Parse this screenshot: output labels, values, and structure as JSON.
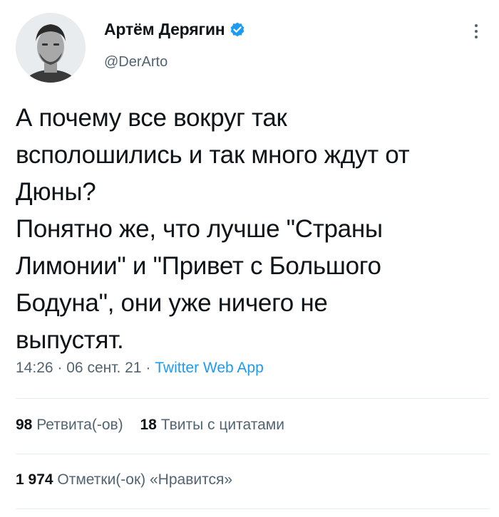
{
  "author": {
    "display_name": "Артём Дерягин",
    "handle": "@DerArto",
    "verified": true,
    "avatar_icon": "avatar-photo"
  },
  "tweet": {
    "text": "А почему все вокруг так\nвсполошились и так много ждут от\nДюны?\nПонятно же, что лучше \"Страны\nЛимонии\" и \"Привет с Большого\nБодуна\", они уже ничего не\nвыпустят."
  },
  "meta": {
    "time": "14:26",
    "separator": "·",
    "date": "06 сент. 21",
    "source": "Twitter Web App"
  },
  "stats": {
    "retweets_count": "98",
    "retweets_label": "Ретвита(-ов)",
    "quotes_count": "18",
    "quotes_label": "Твиты с цитатами",
    "likes_count": "1 974",
    "likes_label": "Отметки(-ок) «Нравится»"
  },
  "colors": {
    "accent": "#1d9bf0",
    "text": "#0f1419",
    "secondary": "#536471"
  }
}
